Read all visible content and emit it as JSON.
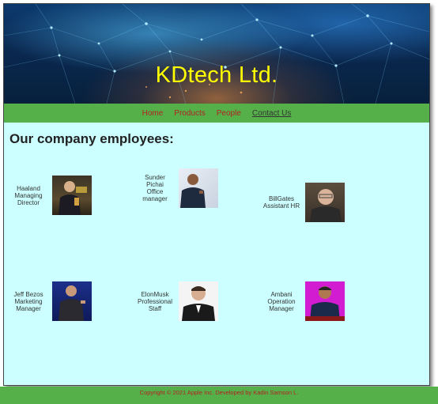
{
  "banner": {
    "title": "KDtech Ltd."
  },
  "nav": {
    "items": [
      {
        "label": "Home"
      },
      {
        "label": "Products"
      },
      {
        "label": "People"
      },
      {
        "label": "Contact Us"
      }
    ]
  },
  "main": {
    "heading": "Our company employees:"
  },
  "employees": [
    {
      "lines": [
        "Haaland",
        "Managing",
        "Director"
      ]
    },
    {
      "lines": [
        "Sunder",
        "Pichai",
        "Office",
        "manager"
      ]
    },
    {
      "lines": [
        "BillGates",
        "Assistant HR"
      ]
    },
    {
      "lines": [
        "Jeff Bezos",
        "Marketing",
        "Manager"
      ]
    },
    {
      "lines": [
        "ElonMusk",
        "Professional",
        "Staff"
      ]
    },
    {
      "lines": [
        "Ambani",
        "Operation",
        "Manager"
      ]
    }
  ],
  "footer": {
    "text": "Copyright © 2021 Apple Inc. Developed by Kadin Samson L."
  },
  "colors": {
    "page_bg": "#ccffff",
    "nav_bg": "#55b04a",
    "nav_link": "#b22222",
    "title": "#ffff00"
  }
}
